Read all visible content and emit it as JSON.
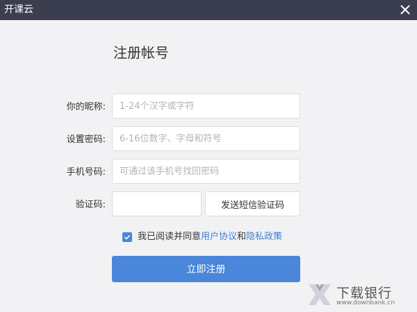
{
  "window": {
    "title": "开课云",
    "close_icon": "close-icon"
  },
  "form": {
    "heading": "注册帐号",
    "nickname": {
      "label": "你的昵称:",
      "value": "",
      "placeholder": "1-24个汉字或字符"
    },
    "password": {
      "label": "设置密码:",
      "value": "",
      "placeholder": "6-16位数字、字母和符号"
    },
    "phone": {
      "label": "手机号码:",
      "value": "",
      "placeholder": "可通过该手机号找回密码"
    },
    "code": {
      "label": "验证码:",
      "value": "",
      "placeholder": ""
    },
    "send_code_label": "发送短信验证码",
    "agreement": {
      "checked": true,
      "prefix": "我已阅读并同意",
      "user_agreement": "用户协议",
      "and": "和",
      "privacy_policy": "隐私政策"
    },
    "submit_label": "立即注册"
  },
  "watermark": {
    "name": "下载银行",
    "url": "www.downbank.cn"
  },
  "colors": {
    "titlebar": "#3a3e4f",
    "accent": "#4a86d9",
    "link": "#3f7fd4",
    "background": "#f2f2f4"
  }
}
